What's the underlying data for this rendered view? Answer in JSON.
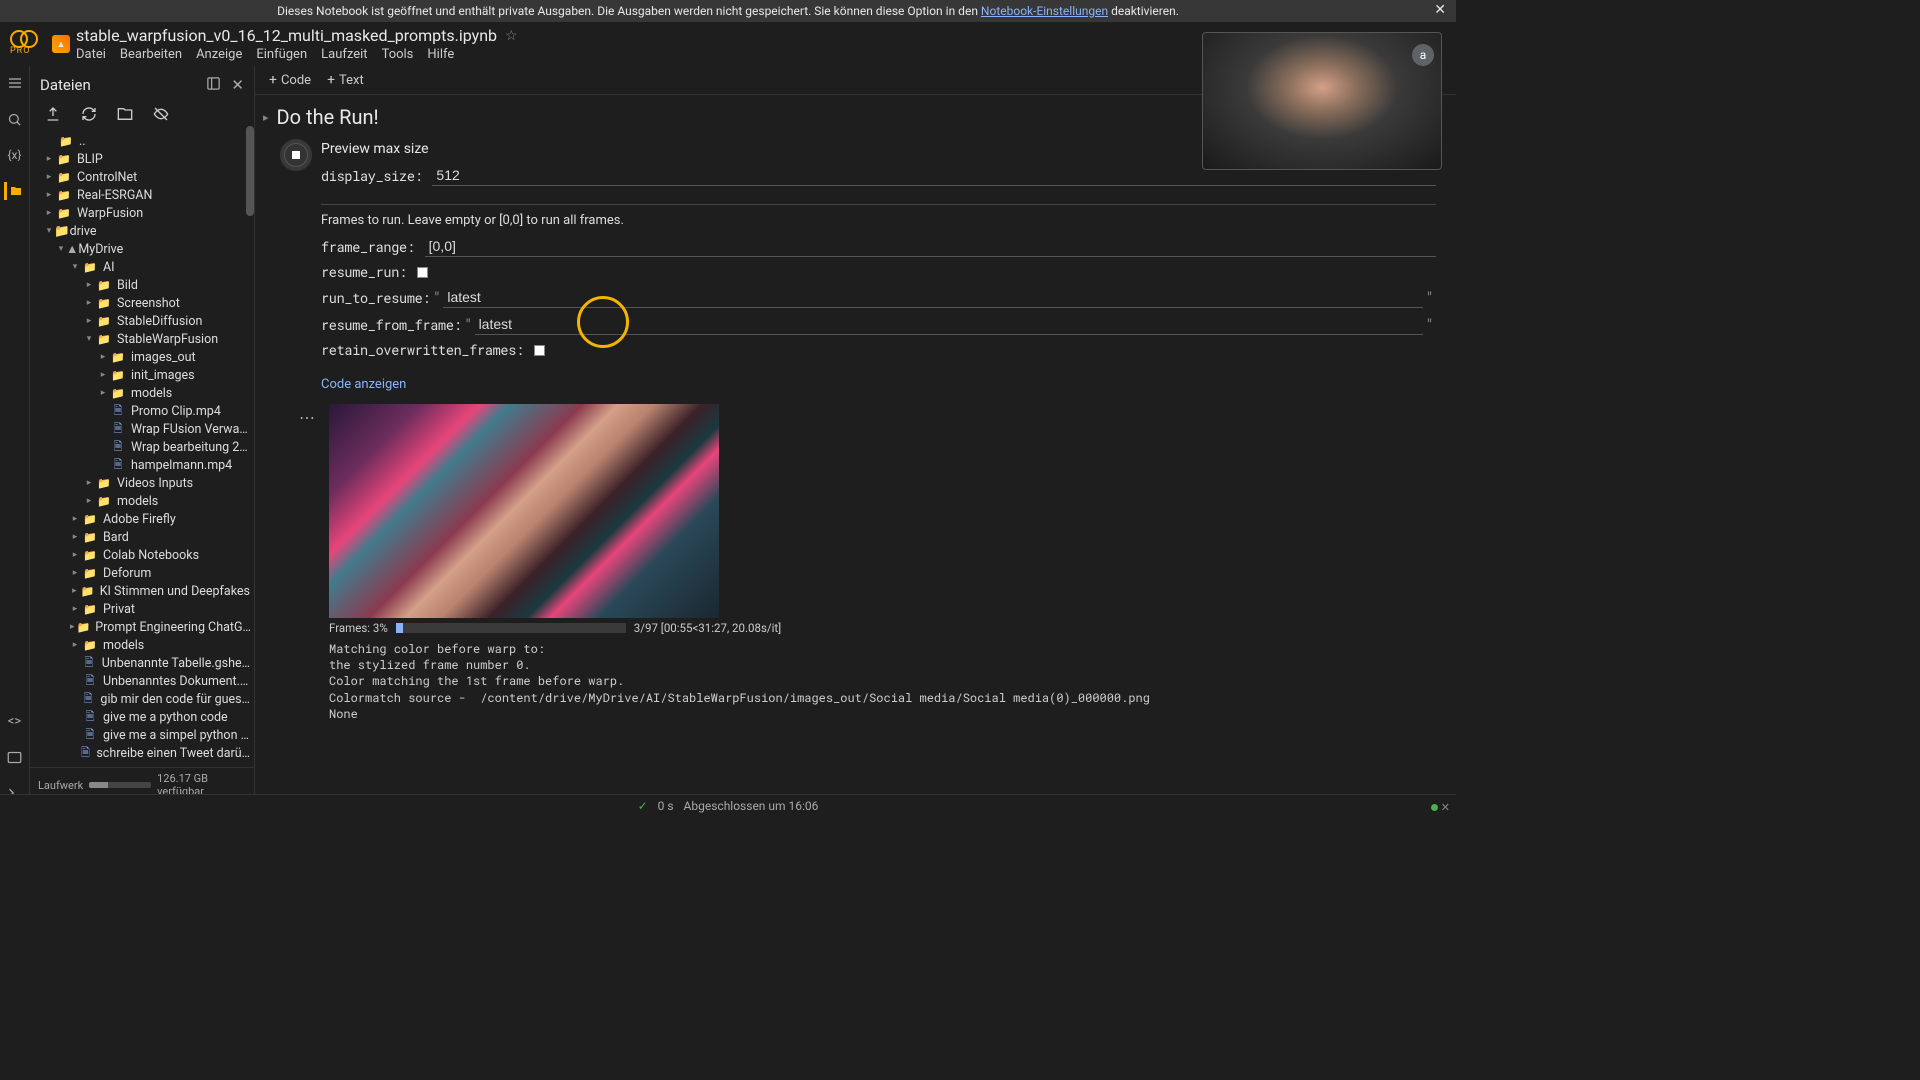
{
  "banner": {
    "text_before": "Dieses Notebook ist geöffnet und enthält private Ausgaben. Die Ausgaben werden nicht gespeichert. Sie können diese Option in den ",
    "link": "Notebook-Einstellungen",
    "text_after": " deaktivieren."
  },
  "header": {
    "pro": "PRO",
    "title": "stable_warpfusion_v0_16_12_multi_masked_prompts.ipynb",
    "avatar_initial": "a"
  },
  "menu": {
    "file": "Datei",
    "edit": "Bearbeiten",
    "view": "Anzeige",
    "insert": "Einfügen",
    "runtime": "Laufzeit",
    "tools": "Tools",
    "help": "Hilfe"
  },
  "toolbar": {
    "code": "Code",
    "text": "Text"
  },
  "sidebar": {
    "title": "Dateien",
    "quota_label": "Laufwerk",
    "quota_text": "126.17 GB verfügbar",
    "tree": {
      "dotdot": "..",
      "blip": "BLIP",
      "controlnet": "ControlNet",
      "realesrgan": "Real-ESRGAN",
      "warpfusion": "WarpFusion",
      "drive": "drive",
      "mydrive": "MyDrive",
      "ai": "AI",
      "bild": "Bild",
      "screenshot": "Screenshot",
      "stablediffusion": "StableDiffusion",
      "stablewarpfusion": "StableWarpFusion",
      "images_out": "images_out",
      "init_images": "init_images",
      "models_swf": "models",
      "promo": "Promo Clip.mp4",
      "wrapfusion": "Wrap FUsion Verwa…",
      "wrapbearbeitung": "Wrap bearbeitung 2…",
      "hampelmann": "hampelmann.mp4",
      "videosinputs": "Videos Inputs",
      "models_ai": "models",
      "adobefirefly": "Adobe Firefly",
      "bard": "Bard",
      "colabnotebooks": "Colab Notebooks",
      "deforum": "Deforum",
      "kistimmen": "KI Stimmen und Deepfakes",
      "privat": "Privat",
      "promptengineering": "Prompt Engineering ChatG…",
      "models_drive": "models",
      "unbenanntetabelle": "Unbenannte Tabelle.gshe…",
      "unbenanntesdokument": "Unbenanntes Dokument.…",
      "gibmircode": "gib mir den code für gues…",
      "python_code": "give me a python code",
      "simpel_python": "give me a simpel python …",
      "tweet": "schreibe einen Tweet darü…"
    }
  },
  "notebook": {
    "section_title": "Do the Run!",
    "preview_title": "Preview max size",
    "display_size_label": "display_size:",
    "display_size_value": "512",
    "frames_desc": "Frames to run. Leave empty or [0,0] to run all frames.",
    "frame_range_label": "frame_range:",
    "frame_range_value": "[0,0]",
    "resume_run_label": "resume_run:",
    "run_to_resume_label": "run_to_resume:",
    "run_to_resume_value": "latest",
    "resume_from_frame_label": "resume_from_frame:",
    "resume_from_frame_value": "latest",
    "retain_label": "retain_overwritten_frames:",
    "show_code": "Code anzeigen",
    "progress_label": "Frames: 3%",
    "progress_info": "3/97 [00:55<31:27, 20.08s/it]",
    "log": "Matching color before warp to:\nthe stylized frame number 0.\nColor matching the 1st frame before warp.\nColormatch source -  /content/drive/MyDrive/AI/StableWarpFusion/images_out/Social media/Social media(0)_000000.png\nNone"
  },
  "status": {
    "time": "0 s",
    "done": "Abgeschlossen um 16:06"
  }
}
